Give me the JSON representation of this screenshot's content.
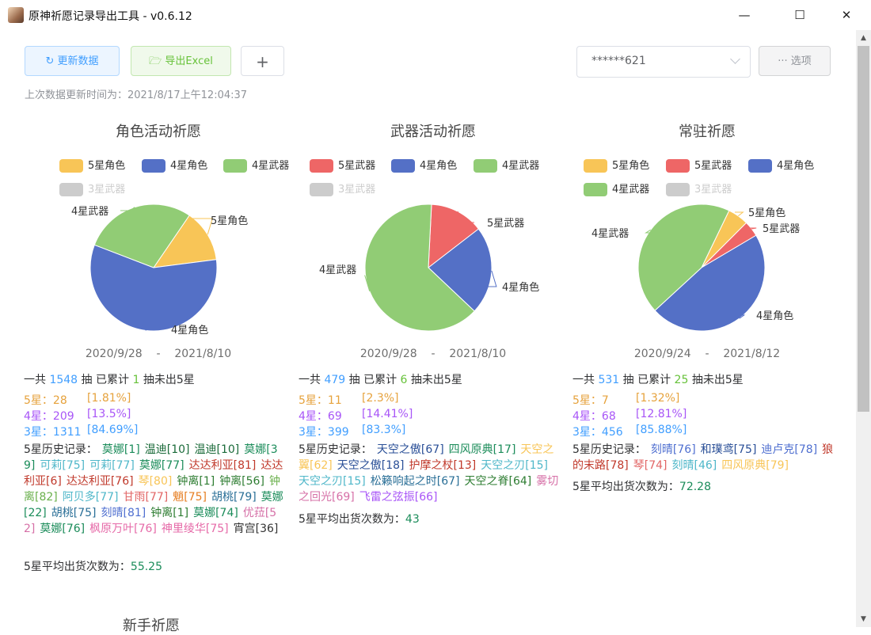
{
  "window": {
    "title": "原神祈愿记录导出工具 - v0.6.12",
    "minimize": "—",
    "maximize": "☐",
    "close": "✕"
  },
  "toolbar": {
    "refresh_label": "更新数据",
    "export_label": "导出Excel",
    "add_label": "+",
    "options_label": "选项",
    "account_value": "******621"
  },
  "last_update": "上次数据更新时间为：2021/8/17上午12:04:37",
  "colors": {
    "5星角色": "#f8c557",
    "4星角色": "#5470c6",
    "4星武器": "#91cc75",
    "5星武器": "#ee6666",
    "3星武器": "#cccccc"
  },
  "panels": [
    {
      "title": "角色活动祈愿",
      "legend": [
        {
          "label": "5星角色",
          "color": "#f8c557",
          "off": false
        },
        {
          "label": "4星角色",
          "color": "#5470c6",
          "off": false
        },
        {
          "label": "4星武器",
          "color": "#91cc75",
          "off": false
        },
        {
          "label": "3星武器",
          "color": "#cccccc",
          "off": true
        }
      ],
      "pie": [
        {
          "name": "5星角色",
          "value": 28,
          "color": "#f8c557"
        },
        {
          "name": "4星角色",
          "value": 121,
          "color": "#5470c6"
        },
        {
          "name": "4星武器",
          "value": 60,
          "color": "#91cc75"
        }
      ],
      "pie_labels": [
        "5星角色",
        "4星角色",
        "4星武器"
      ],
      "date_start": "2020/9/28",
      "date_sep": "-",
      "date_end": "2021/8/10",
      "summary": {
        "pre": "一共",
        "total": "1548",
        "mid": "抽 已累计",
        "pity": "1",
        "post": "抽未出5星"
      },
      "stats": [
        {
          "label": "5星：",
          "count": "28",
          "pct": "[1.81%]"
        },
        {
          "label": "4星：",
          "count": "209",
          "pct": "[13.5%]"
        },
        {
          "label": "3星：",
          "count": "1311",
          "pct": "[84.69%]"
        }
      ],
      "history_label": "5星历史记录：",
      "history": [
        {
          "t": "莫娜[1]",
          "c": "#1b8c5a"
        },
        {
          "t": "温迪[10]",
          "c": "#1b6b3a"
        },
        {
          "t": "温迪[10]",
          "c": "#1b6b3a"
        },
        {
          "t": "莫娜[39]",
          "c": "#1b8c5a"
        },
        {
          "t": "可莉[75]",
          "c": "#4fb7c9"
        },
        {
          "t": "可莉[77]",
          "c": "#4fb7c9"
        },
        {
          "t": "莫娜[77]",
          "c": "#1b8c5a"
        },
        {
          "t": "达达利亚[81]",
          "c": "#c0392b"
        },
        {
          "t": "达达利亚[6]",
          "c": "#c0392b"
        },
        {
          "t": "达达利亚[76]",
          "c": "#c0392b"
        },
        {
          "t": "琴[80]",
          "c": "#f8c557"
        },
        {
          "t": "钟离[1]",
          "c": "#2e7d32"
        },
        {
          "t": "钟离[56]",
          "c": "#2e7d32"
        },
        {
          "t": "钟离[82]",
          "c": "#6ab04c"
        },
        {
          "t": "阿贝多[77]",
          "c": "#4fb7c9"
        },
        {
          "t": "甘雨[77]",
          "c": "#e26666"
        },
        {
          "t": "魈[75]",
          "c": "#e67e22"
        },
        {
          "t": "胡桃[79]",
          "c": "#2a6f97"
        },
        {
          "t": "莫娜[22]",
          "c": "#1b8c5a"
        },
        {
          "t": "胡桃[75]",
          "c": "#2a6f97"
        },
        {
          "t": "刻晴[81]",
          "c": "#4f6fd0"
        },
        {
          "t": "钟离[1]",
          "c": "#2e7d32"
        },
        {
          "t": "莫娜[74]",
          "c": "#1b8c5a"
        },
        {
          "t": "优菈[52]",
          "c": "#d670a7"
        },
        {
          "t": "莫娜[76]",
          "c": "#1b8c5a"
        },
        {
          "t": "枫原万叶[76]",
          "c": "#e66aa8"
        },
        {
          "t": "神里绫华[75]",
          "c": "#e66aa8"
        },
        {
          "t": "宵宫[36]",
          "c": "#333333"
        }
      ],
      "avg_label": "5星平均出货次数为：",
      "avg_value": "55.25"
    },
    {
      "title": "武器活动祈愿",
      "legend": [
        {
          "label": "5星武器",
          "color": "#ee6666",
          "off": false
        },
        {
          "label": "4星角色",
          "color": "#5470c6",
          "off": false
        },
        {
          "label": "4星武器",
          "color": "#91cc75",
          "off": false
        },
        {
          "label": "3星武器",
          "color": "#cccccc",
          "off": true
        }
      ],
      "pie": [
        {
          "name": "5星武器",
          "value": 11,
          "color": "#ee6666"
        },
        {
          "name": "4星角色",
          "value": 18,
          "color": "#5470c6"
        },
        {
          "name": "4星武器",
          "value": 51,
          "color": "#91cc75"
        }
      ],
      "pie_labels": [
        "5星武器",
        "4星角色",
        "4星武器"
      ],
      "date_start": "2020/9/28",
      "date_sep": "-",
      "date_end": "2021/8/10",
      "summary": {
        "pre": "一共",
        "total": "479",
        "mid": "抽 已累计",
        "pity": "6",
        "post": "抽未出5星"
      },
      "stats": [
        {
          "label": "5星：",
          "count": "11",
          "pct": "[2.3%]"
        },
        {
          "label": "4星：",
          "count": "69",
          "pct": "[14.41%]"
        },
        {
          "label": "3星：",
          "count": "399",
          "pct": "[83.3%]"
        }
      ],
      "history_label": "5星历史记录：",
      "history": [
        {
          "t": "天空之傲[67]",
          "c": "#2a4f97"
        },
        {
          "t": "四风原典[17]",
          "c": "#1b8c5a"
        },
        {
          "t": "天空之翼[62]",
          "c": "#f8c557"
        },
        {
          "t": "天空之傲[18]",
          "c": "#2a4f97"
        },
        {
          "t": "护摩之杖[13]",
          "c": "#c0392b"
        },
        {
          "t": "天空之刃[15]",
          "c": "#4fb7c9"
        },
        {
          "t": "天空之刃[15]",
          "c": "#4fb7c9"
        },
        {
          "t": "松籁响起之时[67]",
          "c": "#2a6f97"
        },
        {
          "t": "天空之脊[64]",
          "c": "#2e7d32"
        },
        {
          "t": "雾切之回光[69]",
          "c": "#d670a7"
        },
        {
          "t": "飞雷之弦振[66]",
          "c": "#a855f7"
        }
      ],
      "avg_label": "5星平均出货次数为：",
      "avg_value": "43"
    },
    {
      "title": "常驻祈愿",
      "legend": [
        {
          "label": "5星角色",
          "color": "#f8c557",
          "off": false
        },
        {
          "label": "5星武器",
          "color": "#ee6666",
          "off": false
        },
        {
          "label": "4星角色",
          "color": "#5470c6",
          "off": false
        },
        {
          "label": "4星武器",
          "color": "#91cc75",
          "off": false
        },
        {
          "label": "3星武器",
          "color": "#cccccc",
          "off": true
        }
      ],
      "pie": [
        {
          "name": "5星角色",
          "value": 4,
          "color": "#f8c557"
        },
        {
          "name": "5星武器",
          "value": 3,
          "color": "#ee6666"
        },
        {
          "name": "4星角色",
          "value": 35,
          "color": "#5470c6"
        },
        {
          "name": "4星武器",
          "value": 33,
          "color": "#91cc75"
        }
      ],
      "pie_labels": [
        "5星角色",
        "5星武器",
        "4星角色",
        "4星武器"
      ],
      "date_start": "2020/9/24",
      "date_sep": "-",
      "date_end": "2021/8/12",
      "summary": {
        "pre": "一共",
        "total": "531",
        "mid": "抽 已累计",
        "pity": "25",
        "post": "抽未出5星"
      },
      "stats": [
        {
          "label": "5星：",
          "count": "7",
          "pct": "[1.32%]"
        },
        {
          "label": "4星：",
          "count": "68",
          "pct": "[12.81%]"
        },
        {
          "label": "3星：",
          "count": "456",
          "pct": "[85.88%]"
        }
      ],
      "history_label": "5星历史记录：",
      "history": [
        {
          "t": "刻晴[76]",
          "c": "#4f6fd0"
        },
        {
          "t": "和璞鸢[75]",
          "c": "#2a4f97"
        },
        {
          "t": "迪卢克[78]",
          "c": "#4f6fd0"
        },
        {
          "t": "狼的末路[78]",
          "c": "#c0392b"
        },
        {
          "t": "琴[74]",
          "c": "#e26666"
        },
        {
          "t": "刻晴[46]",
          "c": "#4fb7c9"
        },
        {
          "t": "四风原典[79]",
          "c": "#f8c557"
        }
      ],
      "avg_label": "5星平均出货次数为：",
      "avg_value": "72.28"
    }
  ],
  "bottom_title": "新手祈愿"
}
